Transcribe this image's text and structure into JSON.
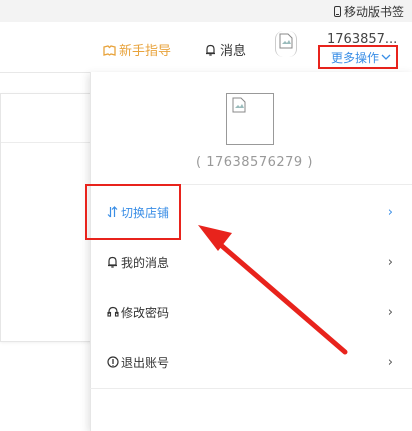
{
  "bookmarks": {
    "mobile_label": "移动版书签"
  },
  "header": {
    "guide_label": "新手指导",
    "messages_label": "消息",
    "user_id": "1763857...",
    "more_ops_label": "更多操作"
  },
  "dropdown": {
    "phone": "( 17638576279 )",
    "items": [
      {
        "label": "切换店铺",
        "icon": "switch-arrows-icon",
        "chevron": "›"
      },
      {
        "label": "我的消息",
        "icon": "bell-icon",
        "chevron": "›"
      },
      {
        "label": "修改密码",
        "icon": "headset-icon",
        "chevron": "›"
      },
      {
        "label": "退出账号",
        "icon": "info-circle-icon",
        "chevron": "›"
      }
    ]
  },
  "colors": {
    "accent": "#3a8ee6",
    "guide": "#e8a33c",
    "annotation_red": "#e8231c"
  }
}
